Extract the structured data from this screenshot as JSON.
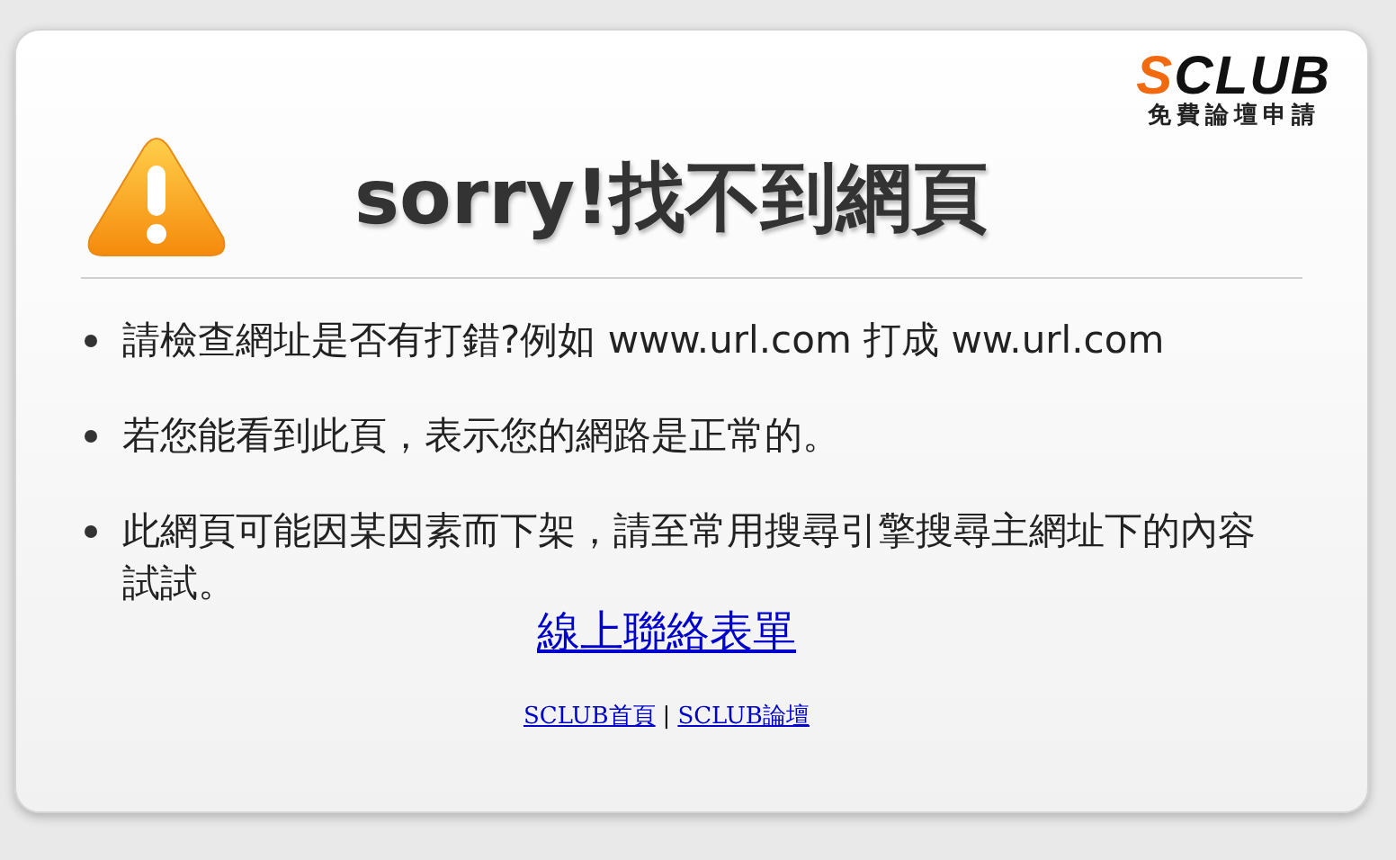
{
  "logo": {
    "accent": "S",
    "rest": "CLUB",
    "tagline": "免費論壇申請"
  },
  "title": "sorry!找不到網頁",
  "items": [
    {
      "text": "請檢查網址是否有打錯?例如 www.url.com 打成 ww.url.com"
    },
    {
      "text": "若您能看到此頁，表示您的網路是正常的。"
    },
    {
      "text": "此網頁可能因某因素而下架，請至常用搜尋引擎搜尋主網址下的內容試試。"
    }
  ],
  "contact_link": "線上聯絡表單",
  "footer_links": [
    "SCLUB首頁",
    "SCLUB論壇"
  ],
  "footer_separator": "|"
}
